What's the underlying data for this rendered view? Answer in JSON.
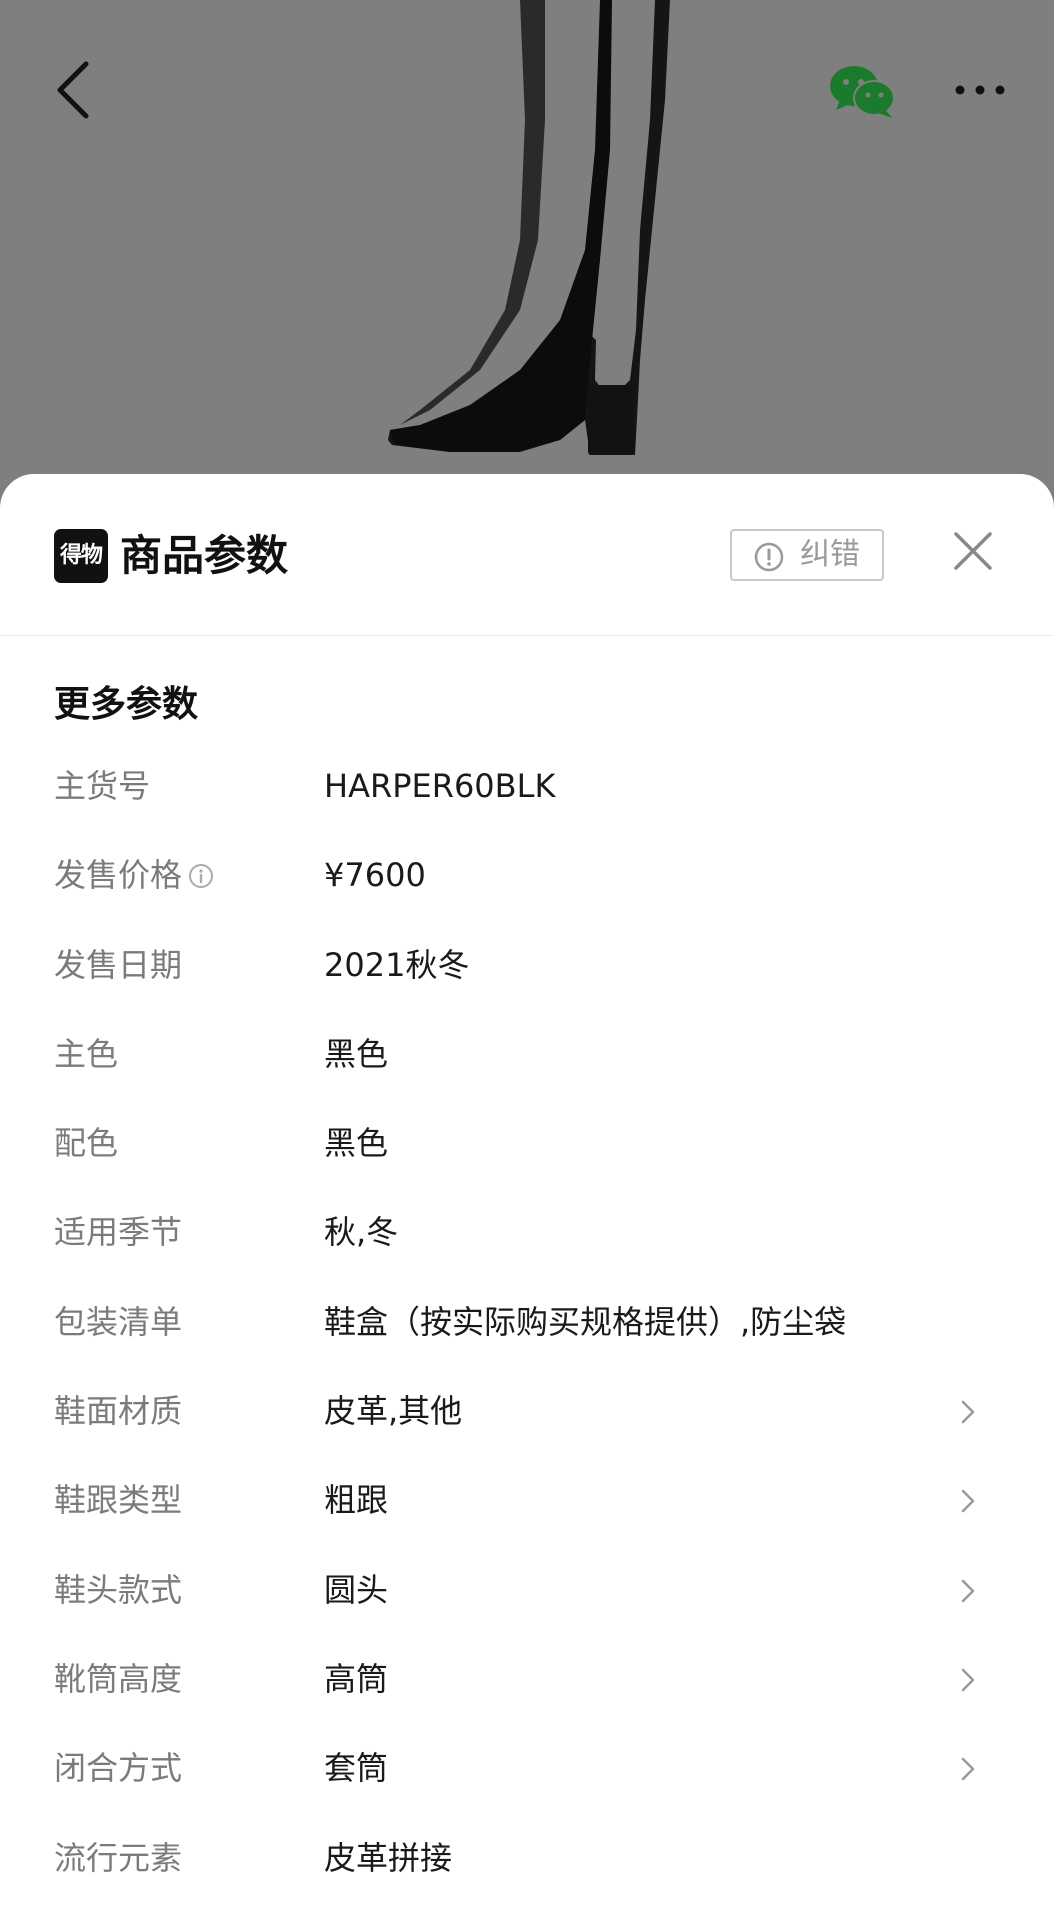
{
  "header": {
    "title": "商品参数",
    "brand_logo_text": "得物",
    "report_label": "纠错"
  },
  "section": {
    "title": "更多参数"
  },
  "params": [
    {
      "key": "主货号",
      "value": "HARPER60BLK",
      "info": false,
      "arrow": false
    },
    {
      "key": "发售价格",
      "value": "¥7600",
      "info": true,
      "arrow": false
    },
    {
      "key": "发售日期",
      "value": "2021秋冬",
      "info": false,
      "arrow": false
    },
    {
      "key": "主色",
      "value": "黑色",
      "info": false,
      "arrow": false
    },
    {
      "key": "配色",
      "value": "黑色",
      "info": false,
      "arrow": false
    },
    {
      "key": "适用季节",
      "value": "秋,冬",
      "info": false,
      "arrow": false
    },
    {
      "key": "包装清单",
      "value": "鞋盒（按实际购买规格提供）,防尘袋",
      "info": false,
      "arrow": false
    },
    {
      "key": "鞋面材质",
      "value": "皮革,其他",
      "info": false,
      "arrow": true
    },
    {
      "key": "鞋跟类型",
      "value": "粗跟",
      "info": false,
      "arrow": true
    },
    {
      "key": "鞋头款式",
      "value": "圆头",
      "info": false,
      "arrow": true
    },
    {
      "key": "靴筒高度",
      "value": "高筒",
      "info": false,
      "arrow": true
    },
    {
      "key": "闭合方式",
      "value": "套筒",
      "info": false,
      "arrow": true
    },
    {
      "key": "流行元素",
      "value": "皮革拼接",
      "info": false,
      "arrow": false
    }
  ],
  "icons": {
    "back": "chevron-left-icon",
    "share": "wechat-icon",
    "more": "more-dots-icon",
    "close": "close-icon",
    "report": "exclamation-circle-icon",
    "info": "info-icon",
    "row_arrow": "chevron-right-icon"
  },
  "colors": {
    "backdrop": "#7f7f80",
    "wechat_green": "#1aad19",
    "key_text": "#7b7b7b",
    "value_text": "#1a1a1a"
  }
}
